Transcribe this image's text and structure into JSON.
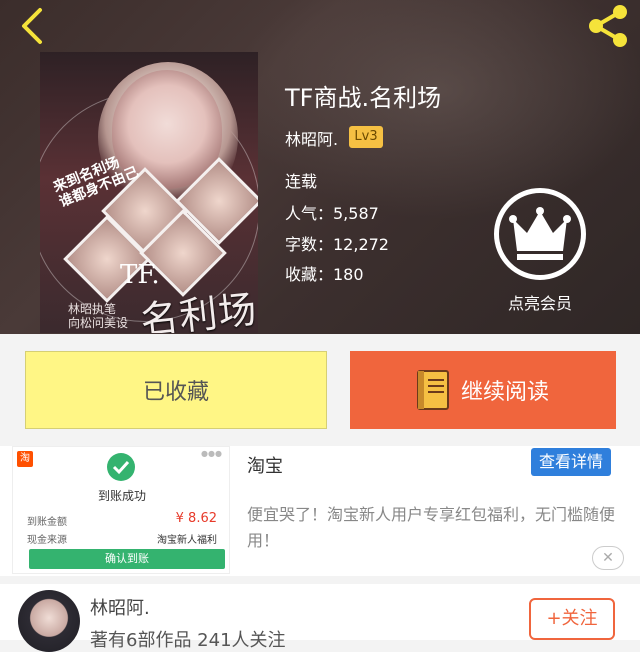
{
  "book": {
    "title": "TF商战.名利场",
    "author": "林昭阿.",
    "level": "Lv3",
    "status": "连载",
    "popularity": "人气：5,587",
    "word_count": "字数：12,272",
    "favorites": "收藏：180"
  },
  "cover": {
    "title_tf": "TF.",
    "title_main": "名利场",
    "slogan": "来到名利场\n谁都身不由己",
    "credit": "林昭执笔\n向松问美设"
  },
  "header": {
    "back_icon": "chevron-left-icon",
    "share_icon": "share-icon",
    "accent": "#f5e33a"
  },
  "vip": {
    "label": "点亮会员",
    "icon": "crown-icon"
  },
  "actions": {
    "favorited_label": "已收藏",
    "continue_label": "继续阅读"
  },
  "ad": {
    "title": "淘宝",
    "detail_label": "查看详情",
    "description": "便宜哭了！淘宝新人用户专享红包福利，无门槛随便用！",
    "close_label": "✕",
    "thumb": {
      "logo": "淘",
      "status": "到账成功",
      "amount_label": "到账金额",
      "amount_value": "¥ 8.62",
      "source_label": "现金来源",
      "source_value": "淘宝新人福利",
      "confirm_label": "确认到账"
    }
  },
  "author_card": {
    "name": "林昭阿.",
    "works": "著有6部作品 241人关注",
    "follow_label": "+关注"
  }
}
